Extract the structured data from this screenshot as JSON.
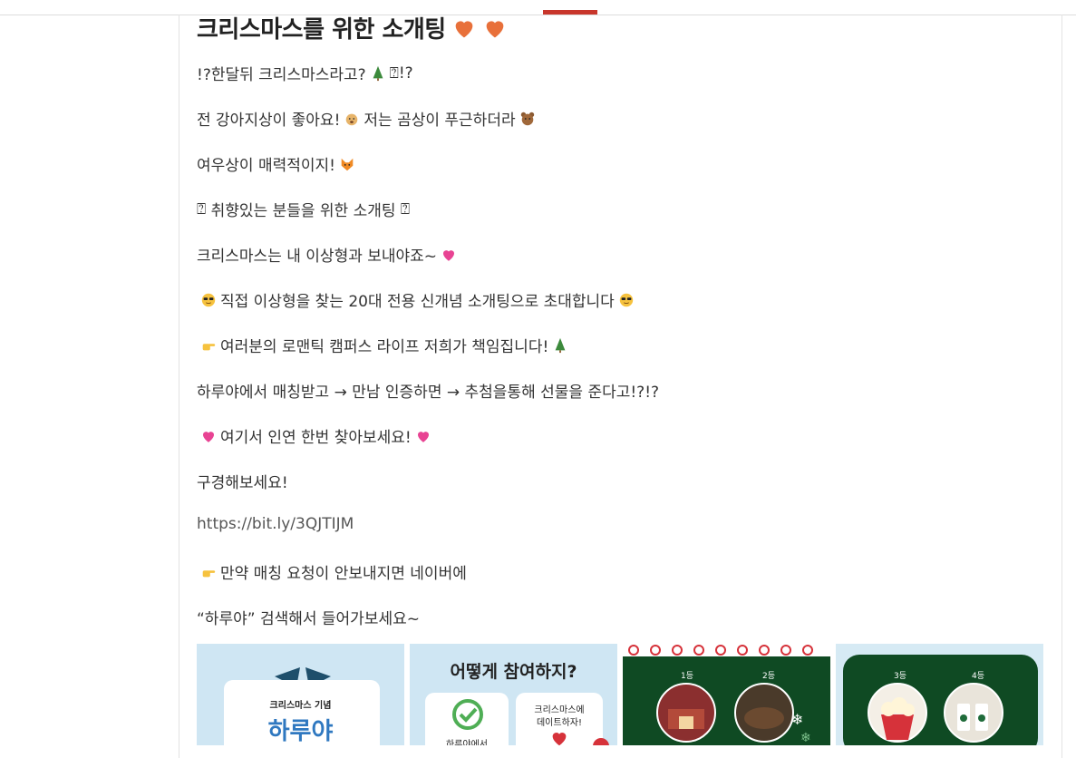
{
  "post": {
    "title": "크리스마스를 위한 소개팅",
    "lines": [
      "!?한달뒤 크리스마스라고?",
      "전 강아지상이 좋아요!",
      "저는 곰상이 푸근하더라",
      "여우상이 매력적이지!",
      "취향있는 분들을 위한 소개팅",
      "크리스마스는 내 이상형과 보내야죠~",
      "직접 이상형을 찾는 20대 전용 신개념 소개팅으로 초대합니다",
      "여러분의 로맨틱 캠퍼스 라이프 저희가 책임집니다!",
      "하루야에서 매칭받고 → 만남 인증하면 → 추첨을통해 선물을 준다고!?!?",
      "여기서 인연 한번 찾아보세요!",
      "구경해보세요!",
      "https://bit.ly/3QJTIJM",
      "만약 매칭 요청이 안보내지면 네이버에",
      "“하루야” 검색해서 들어가보세요~"
    ]
  },
  "thumbnails": {
    "t1": {
      "small": "크리스마스 기념",
      "big": "하루야"
    },
    "t2": {
      "heading": "어떻게 참여하지?",
      "left": "하루야에서",
      "right1": "크리스마스에",
      "right2": "데이트하자!"
    },
    "t3": {
      "rank1": "1등",
      "rank2": "2등"
    },
    "t4": {
      "rank3": "3등",
      "rank4": "4등"
    }
  },
  "colors": {
    "accent": "#c8362b",
    "heart": "#e8703a",
    "pink": "#e84393"
  },
  "icons": [
    "heart-icon",
    "tree-icon",
    "dog-icon",
    "bear-icon",
    "fox-icon",
    "sparkle-heart-icon",
    "sunglasses-icon",
    "pointing-hand-icon"
  ]
}
